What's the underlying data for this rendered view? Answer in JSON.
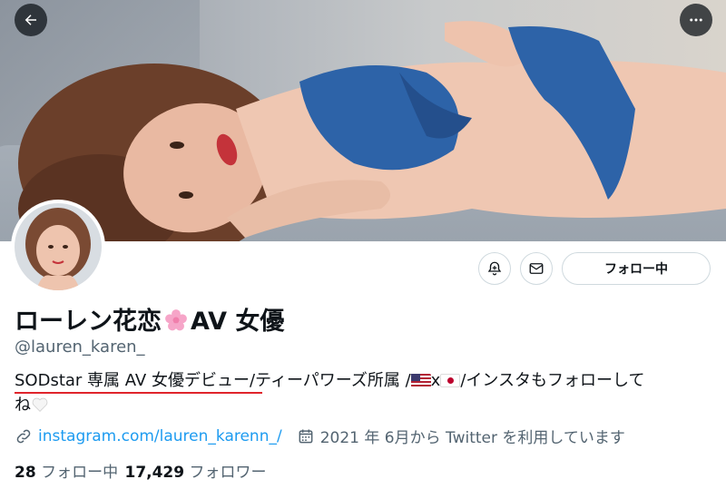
{
  "profile": {
    "display_name": "ローレン花恋",
    "display_name_suffix": "AV 女優",
    "name_emoji": "cherry-blossom-icon",
    "handle": "@lauren_karen_",
    "bio": {
      "part1": "SODstar 専属 AV 女優デビュー",
      "part2": "/ティーパワーズ所属 /",
      "between_flags": "x",
      "part3": "/インスタもフォローして",
      "part4": "ね",
      "flag1": "us-flag-icon",
      "flag2": "jp-flag-icon",
      "end_emoji": "white-heart-icon"
    },
    "link": "instagram.com/lauren_karenn_/",
    "joined": "2021 年 6月から Twitter を利用しています",
    "following_count": "28",
    "following_label": "フォロー中",
    "followers_count": "17,429",
    "followers_label": "フォロワー"
  },
  "actions": {
    "follow_label": "フォロー中",
    "notify_icon": "bell-plus-icon",
    "message_icon": "envelope-icon",
    "back_icon": "arrow-left-icon",
    "more_icon": "ellipsis-icon"
  },
  "colors": {
    "link": "#1d9bf0",
    "secondary_text": "#536471",
    "underline": "#e0242c",
    "bikini": "#2d63a8"
  }
}
